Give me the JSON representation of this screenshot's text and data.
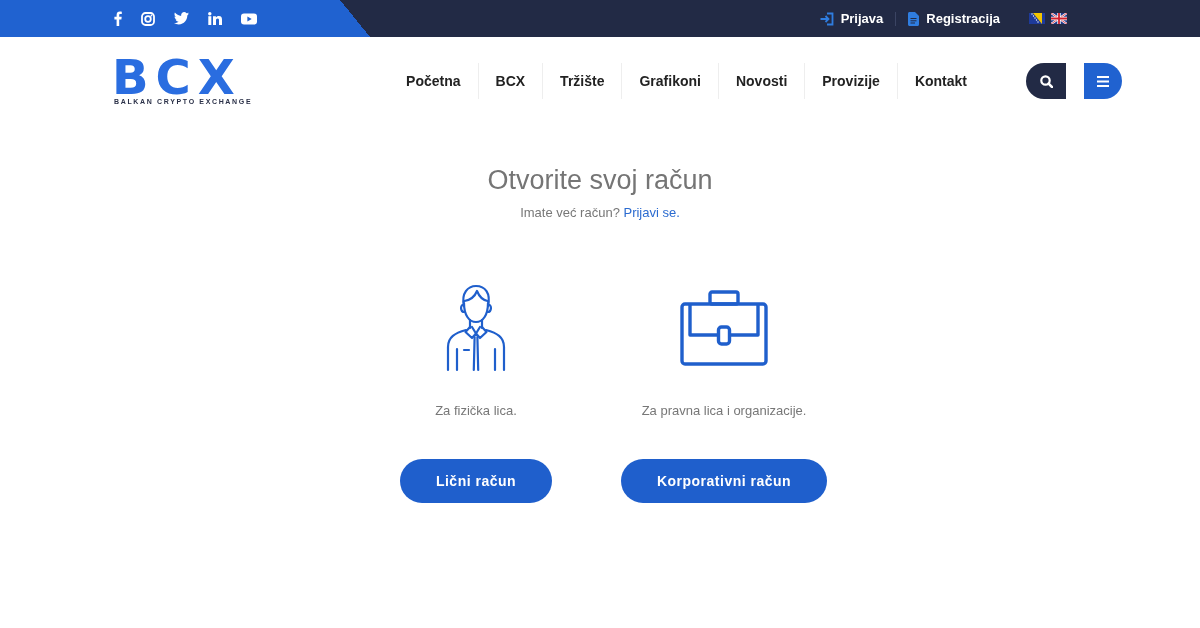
{
  "top_bar": {
    "account_links": [
      {
        "kind": "login",
        "label": "Prijava"
      },
      {
        "kind": "register",
        "label": "Registracija"
      }
    ]
  },
  "header": {
    "logo": {
      "wordmark": "BCX",
      "tagline": "BALKAN CRYPTO EXCHANGE"
    },
    "nav_items": [
      "Početna",
      "BCX",
      "Tržište",
      "Grafikoni",
      "Novosti",
      "Provizije",
      "Kontakt"
    ]
  },
  "hero": {
    "title": "Otvorite svoj račun",
    "prompt": "Imate već račun?",
    "login_link": "Prijavi se.",
    "account_types": [
      {
        "kind": "person",
        "description": "Za fizička lica.",
        "button": "Lični račun"
      },
      {
        "kind": "business",
        "description": "Za pravna lica i organizacije.",
        "button": "Korporativni račun"
      }
    ]
  }
}
